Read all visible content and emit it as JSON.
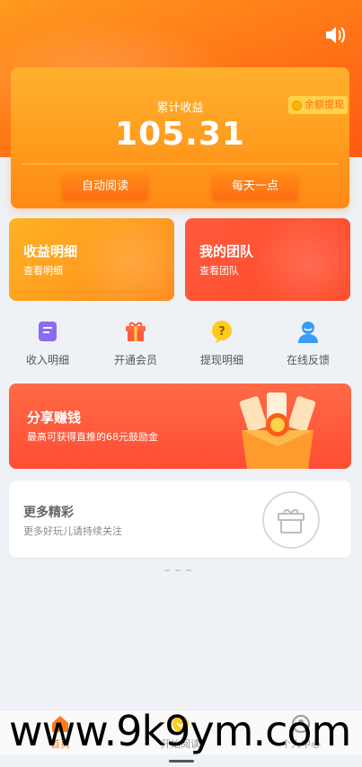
{
  "header": {
    "speaker_icon": "speaker-icon"
  },
  "earnings_card": {
    "label": "累计收益",
    "amount": "105.31",
    "withdraw_tag": "余额提现",
    "buttons": {
      "auto_read": "自动阅读",
      "daily_tap": "每天一点"
    }
  },
  "tiles": [
    {
      "title": "收益明细",
      "subtitle": "查看明细"
    },
    {
      "title": "我的团队",
      "subtitle": "查看团队"
    }
  ],
  "quick_links": [
    {
      "label": "收入明细",
      "icon": "document-icon"
    },
    {
      "label": "开通会员",
      "icon": "gift-box-icon"
    },
    {
      "label": "提现明细",
      "icon": "question-icon"
    },
    {
      "label": "在线反馈",
      "icon": "user-support-icon"
    }
  ],
  "share_banner": {
    "title": "分享赚钱",
    "subtitle": "最高可获得直推的68元鼓励金"
  },
  "more_card": {
    "title": "更多精彩",
    "subtitle": "更多好玩儿请持续关注"
  },
  "tabbar": {
    "items": [
      {
        "label": "首页",
        "icon": "home-icon"
      },
      {
        "label": "开始阅读",
        "icon": "read-icon"
      },
      {
        "label": "个人中心",
        "icon": "profile-icon"
      }
    ]
  },
  "watermark": "www.9k9ym.com",
  "colors": {
    "brand_orange": "#ff7a1a",
    "tile_yellow": "#ffb224",
    "tile_red": "#ff5a3c",
    "share_red": "#ff4d35"
  }
}
